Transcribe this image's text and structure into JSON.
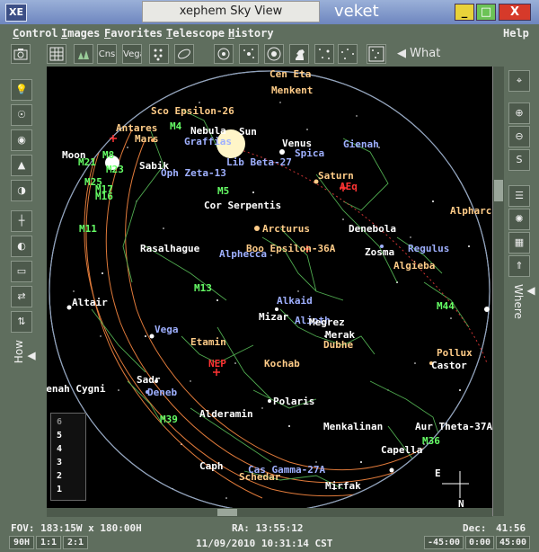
{
  "window": {
    "badge": "XE",
    "title": "xephem Sky View",
    "host": "veket",
    "min_label": "_",
    "max_label": "□",
    "close_label": "X"
  },
  "menu": [
    "Control",
    "Images",
    "Favorites",
    "Telescope",
    "History"
  ],
  "help": "Help",
  "toolbar": {
    "cns_label": "Cns",
    "vega_label": "Vega",
    "what_label": "What"
  },
  "side": {
    "how_label": "How",
    "where_label": "Where"
  },
  "sky": {
    "labels": [
      {
        "text": "Cen Eta",
        "cls": "c-orange"
      },
      {
        "text": "Menkent",
        "cls": "c-orange"
      },
      {
        "text": "Sco Epsilon-26",
        "cls": "c-orange"
      },
      {
        "text": "M4",
        "cls": "c-green"
      },
      {
        "text": "Antares",
        "cls": "c-orange"
      },
      {
        "text": "Mars",
        "cls": "c-orange"
      },
      {
        "text": "Nebula",
        "cls": "c-white"
      },
      {
        "text": "Sun",
        "cls": "c-white"
      },
      {
        "text": "Graffias",
        "cls": "c-star"
      },
      {
        "text": "Venus",
        "cls": "c-white"
      },
      {
        "text": "Gienah",
        "cls": "c-star"
      },
      {
        "text": "Spica",
        "cls": "c-star"
      },
      {
        "text": "Lib Beta-27",
        "cls": "c-star"
      },
      {
        "text": "Moon",
        "cls": "c-white"
      },
      {
        "text": "M8",
        "cls": "c-green"
      },
      {
        "text": "M21",
        "cls": "c-green"
      },
      {
        "text": "M23",
        "cls": "c-green"
      },
      {
        "text": "Sabik",
        "cls": "c-white"
      },
      {
        "text": "Oph Zeta-13",
        "cls": "c-star"
      },
      {
        "text": "Saturn",
        "cls": "c-orange"
      },
      {
        "text": "AEq",
        "cls": "c-red"
      },
      {
        "text": "M25",
        "cls": "c-green"
      },
      {
        "text": "M17",
        "cls": "c-green"
      },
      {
        "text": "M16",
        "cls": "c-green"
      },
      {
        "text": "M5",
        "cls": "c-green"
      },
      {
        "text": "Cor Serpentis",
        "cls": "c-white"
      },
      {
        "text": "Alpharc",
        "cls": "c-orange"
      },
      {
        "text": "M11",
        "cls": "c-green"
      },
      {
        "text": "Arcturus",
        "cls": "c-orange"
      },
      {
        "text": "Denebola",
        "cls": "c-white"
      },
      {
        "text": "Rasalhague",
        "cls": "c-white"
      },
      {
        "text": "Boo Epsilon-36A",
        "cls": "c-orange"
      },
      {
        "text": "Zosma",
        "cls": "c-white"
      },
      {
        "text": "Regulus",
        "cls": "c-star"
      },
      {
        "text": "Alphecca",
        "cls": "c-star"
      },
      {
        "text": "Algieba",
        "cls": "c-orange"
      },
      {
        "text": "M13",
        "cls": "c-green"
      },
      {
        "text": "Altair",
        "cls": "c-white"
      },
      {
        "text": "Alkaid",
        "cls": "c-star"
      },
      {
        "text": "M44",
        "cls": "c-green"
      },
      {
        "text": "Mizar",
        "cls": "c-white"
      },
      {
        "text": "Alioth",
        "cls": "c-star"
      },
      {
        "text": "Megrez",
        "cls": "c-white"
      },
      {
        "text": "Vega",
        "cls": "c-star"
      },
      {
        "text": "Merak",
        "cls": "c-white"
      },
      {
        "text": "Dubhe",
        "cls": "c-orange"
      },
      {
        "text": "Etamin",
        "cls": "c-orange"
      },
      {
        "text": "Pollux",
        "cls": "c-orange"
      },
      {
        "text": "NEP",
        "cls": "c-red"
      },
      {
        "text": "Kochab",
        "cls": "c-orange"
      },
      {
        "text": "Castor",
        "cls": "c-white"
      },
      {
        "text": "Sadr",
        "cls": "c-white"
      },
      {
        "text": "Gienah Cygni",
        "cls": "c-white"
      },
      {
        "text": "Deneb",
        "cls": "c-star"
      },
      {
        "text": "Polaris",
        "cls": "c-white"
      },
      {
        "text": "Alderamin",
        "cls": "c-white"
      },
      {
        "text": "M39",
        "cls": "c-green"
      },
      {
        "text": "Menkalinan",
        "cls": "c-white"
      },
      {
        "text": "Aur Theta-37A",
        "cls": "c-white"
      },
      {
        "text": "M36",
        "cls": "c-green"
      },
      {
        "text": "Capella",
        "cls": "c-white"
      },
      {
        "text": "Caph",
        "cls": "c-white"
      },
      {
        "text": "Cas Gamma-27A",
        "cls": "c-star"
      },
      {
        "text": "Schedar",
        "cls": "c-orange"
      },
      {
        "text": "Mirfak",
        "cls": "c-white"
      },
      {
        "text": "E",
        "cls": "c-white"
      },
      {
        "text": "N",
        "cls": "c-white"
      }
    ],
    "legend": [
      "6",
      "5",
      "4",
      "3",
      "2",
      "1"
    ]
  },
  "status": {
    "fov": "FOV: 183:15W x 180:00H",
    "ra": "RA: 13:55:12",
    "dec_label": "Dec:",
    "dec_value": "41:56",
    "datetime": "11/09/2010 10:31:14 CST",
    "btn_90h": "90H",
    "btn_11": "1:1",
    "btn_21": "2:1",
    "btn_m45": "-45:00",
    "btn_0": "0:00",
    "btn_45": "45:00"
  }
}
